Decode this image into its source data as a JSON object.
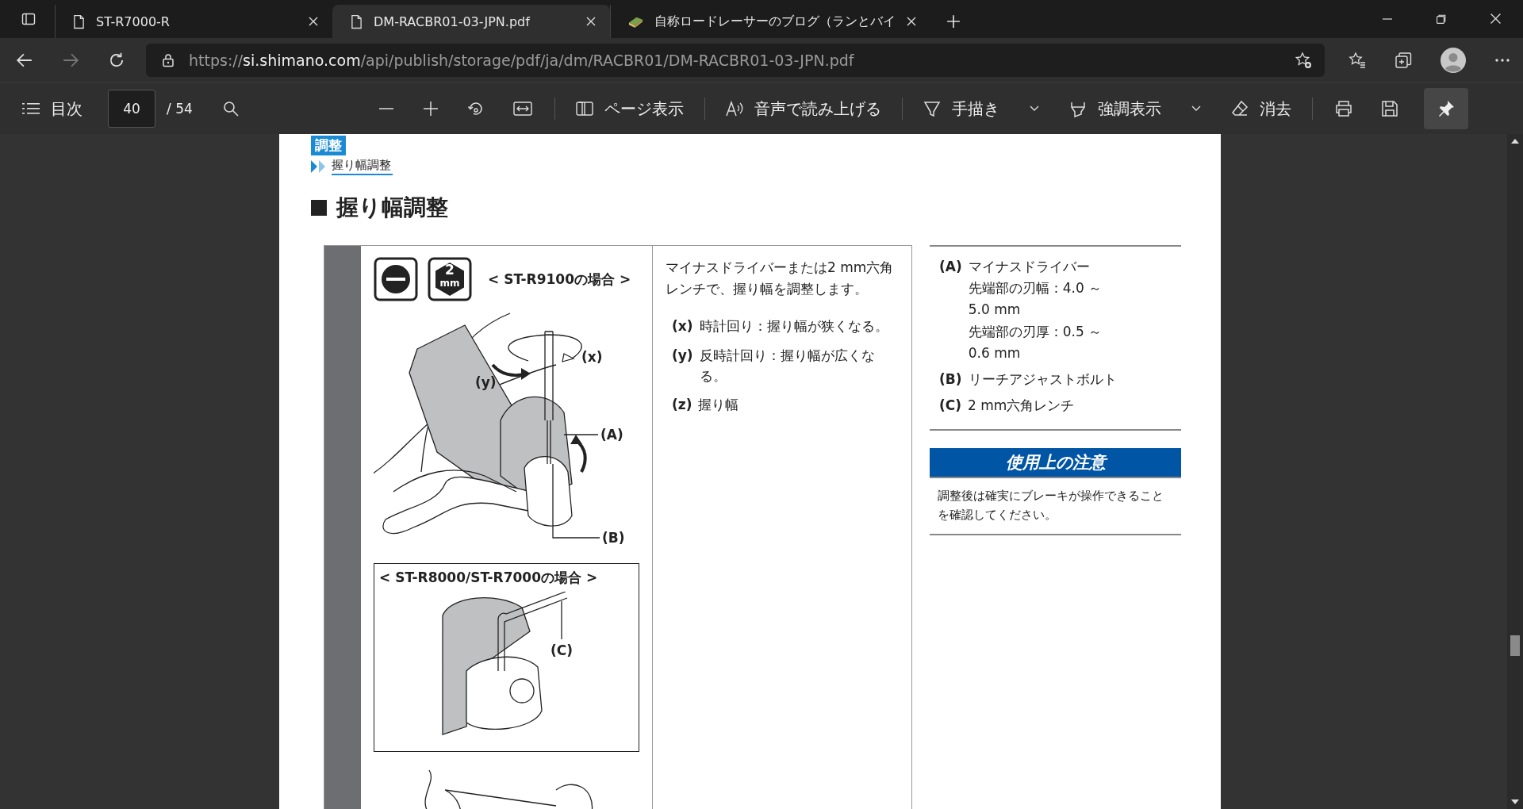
{
  "tabs": [
    {
      "title": "ST-R7000-R",
      "kind": "page",
      "selected": false
    },
    {
      "title": "DM-RACBR01-03-JPN.pdf",
      "kind": "page",
      "selected": true
    },
    {
      "title": "自称ロードレーサーのブログ（ランとバイ",
      "kind": "site",
      "selected": false
    }
  ],
  "address_bar": {
    "scheme": "https://",
    "host": "si.shimano.com",
    "path": "/api/publish/storage/pdf/ja/dm/RACBR01/DM-RACBR01-03-JPN.pdf"
  },
  "pdf_toolbar": {
    "contents_label": "目次",
    "page_number": "40",
    "page_total": "/ 54",
    "tools": [
      {
        "kind": "page_view",
        "label": "ページ表示",
        "dropdown": false
      },
      {
        "kind": "read_aloud",
        "label": "音声で読み上げる",
        "dropdown": false
      },
      {
        "kind": "draw",
        "label": "手描き",
        "dropdown": true
      },
      {
        "kind": "highlight",
        "label": "強調表示",
        "dropdown": true
      },
      {
        "kind": "erase",
        "label": "消去",
        "dropdown": false
      }
    ],
    "pinned": true
  },
  "document": {
    "section_tag": "調整",
    "breadcrumb": "握り幅調整",
    "heading": "握り幅調整",
    "tools": [
      {
        "kind": "flathead"
      },
      {
        "kind": "hex",
        "size": "2",
        "unit": "mm"
      }
    ],
    "figure_1": {
      "caption": "< ST-R9100の場合 >",
      "callouts": [
        "(y)",
        "(x)",
        "(A)",
        "(B)"
      ]
    },
    "figure_2": {
      "caption": "< ST-R8000/ST-R7000の場合 >",
      "callouts": [
        "(C)"
      ]
    },
    "instruction": "マイナスドライバーまたは2 mm六角レンチで、握り幅を調整します。",
    "steps": [
      {
        "marker": "(x)",
        "text": "時計回り：握り幅が狭くなる。"
      },
      {
        "marker": "(y)",
        "text": "反時計回り：握り幅が広くなる。"
      },
      {
        "marker": "(z)",
        "text": "握り幅"
      }
    ],
    "parts": [
      {
        "marker": "(A)",
        "lines": [
          "マイナスドライバー",
          "先端部の刃幅：4.0 ～ 5.0 mm",
          "先端部の刃厚：0.5 ～ 0.6 mm"
        ]
      },
      {
        "marker": "(B)",
        "lines": [
          "リーチアジャストボルト"
        ]
      },
      {
        "marker": "(C)",
        "lines": [
          "2 mm六角レンチ"
        ]
      }
    ],
    "caution": {
      "title": "使用上の注意",
      "text": "調整後は確実にブレーキが操作できることを確認してください。"
    }
  }
}
